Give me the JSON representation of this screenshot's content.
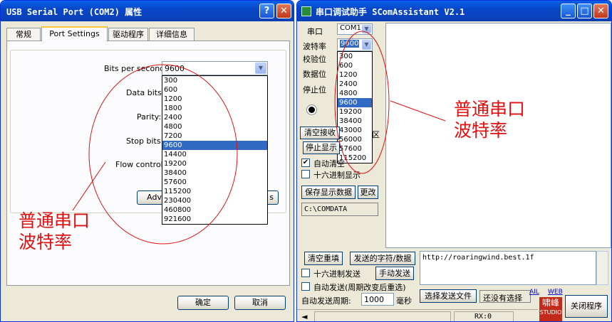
{
  "left_window": {
    "title": "USB Serial Port (COM2) 属性",
    "help_button": "?",
    "close_button": "✕",
    "tabs": [
      "常规",
      "Port Settings",
      "驱动程序",
      "详细信息"
    ],
    "bits_label": "Bits per second:",
    "bits_value": "9600",
    "data_bits_label": "Data bits:",
    "parity_label": "Parity:",
    "stop_bits_label": "Stop bits:",
    "flow_label": "Flow control:",
    "advanced_partial": "Adv",
    "restore_partial": "s",
    "baud_options": [
      "300",
      "600",
      "1200",
      "1800",
      "2400",
      "4800",
      "7200",
      "9600",
      "14400",
      "19200",
      "38400",
      "57600",
      "115200",
      "230400",
      "460800",
      "921600"
    ],
    "selected_baud": "9600",
    "ok_button": "确定",
    "cancel_button": "取消"
  },
  "right_window": {
    "title": "串口调试助手 SComAssistant V2.1",
    "min_button": "_",
    "max_button": "□",
    "close_button": "✕",
    "port_label": "串口",
    "port_value": "COM1",
    "baud_label": "波特率",
    "baud_value": "9600",
    "parity_label": "校验位",
    "databits_label": "数据位",
    "stopbits_label": "停止位",
    "baud_options": [
      "300",
      "600",
      "1200",
      "2400",
      "4800",
      "9600",
      "19200",
      "38400",
      "43000",
      "56000",
      "57600",
      "115200"
    ],
    "selected_baud": "9600",
    "clear_recv_button": "清空接收",
    "clear_recv_tail": "区",
    "stop_display_button": "停止显示",
    "auto_clear_label": "自动清空",
    "hex_display_label": "十六进制显示",
    "save_display_button": "保存显示数据",
    "change_button": "更改",
    "save_path": "C:\\COMDATA",
    "clear_resend_button": "清空重填",
    "send_chars_label": "发送的字符/数据",
    "send_text": "http://roaringwind.best.1f",
    "hex_send_label": "十六进制发送",
    "manual_send_button": "手动发送",
    "auto_send_label": "自动发送(周期改变后重选)",
    "auto_period_label": "自动发送周期:",
    "auto_period_value": "1000",
    "ms_label": "毫秒",
    "choose_file_button": "选择发送文件",
    "no_file_text": "还没有选择",
    "link_ail": "AIL",
    "link_web": "WEB",
    "logo_top": "啸峰",
    "logo_bottom": "STUDIO",
    "close_program_button": "关闭程序",
    "rx_status": "RX:0"
  },
  "annotations": {
    "left_line1": "普通串口",
    "left_line2": "波特率",
    "right_line1": "普通串口",
    "right_line2": "波特率",
    "color": "#e01010"
  },
  "colors": {
    "title_bar": "#0a5fe8",
    "dialog_bg": "#ece9d8",
    "selection": "#316ac5"
  }
}
